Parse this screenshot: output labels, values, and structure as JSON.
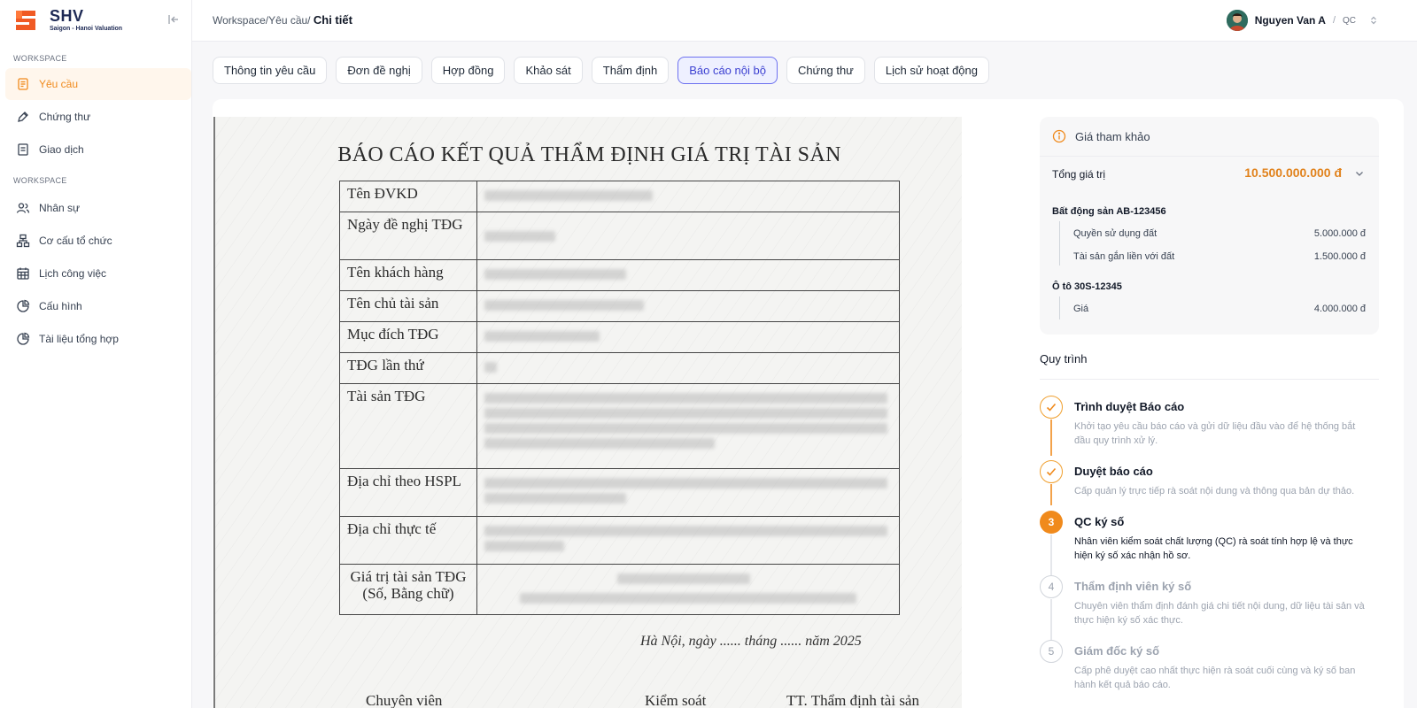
{
  "brand": {
    "name": "SHV",
    "subtitle": "Saigon - Hanoi Valuation"
  },
  "sidebar": {
    "section1": "WORKSPACE",
    "section2": "WORKSPACE",
    "items": [
      {
        "label": "Yêu cầu",
        "icon": "request-icon",
        "active": true
      },
      {
        "label": "Chứng thư",
        "icon": "pen-icon",
        "active": false
      },
      {
        "label": "Giao dịch",
        "icon": "document-icon",
        "active": false
      },
      {
        "label": "Nhân sự",
        "icon": "users-icon",
        "active": false
      },
      {
        "label": "Cơ cấu tổ chức",
        "icon": "org-chart-icon",
        "active": false
      },
      {
        "label": "Lịch công việc",
        "icon": "calendar-icon",
        "active": false
      },
      {
        "label": "Cấu hình",
        "icon": "pie-chart-icon",
        "active": false
      },
      {
        "label": "Tài liệu tổng hợp",
        "icon": "pie-chart-icon",
        "active": false
      }
    ]
  },
  "header": {
    "breadcrumb_prefix": "Workspace/Yêu cầu/",
    "breadcrumb_current": "Chi tiết",
    "user_name": "Nguyen Van A",
    "user_sep": "/",
    "user_role": "QC"
  },
  "tabs": [
    {
      "label": "Thông tin yêu cầu",
      "active": false
    },
    {
      "label": "Đơn đề nghị",
      "active": false
    },
    {
      "label": "Hợp đồng",
      "active": false
    },
    {
      "label": "Khảo sát",
      "active": false
    },
    {
      "label": "Thẩm định",
      "active": false
    },
    {
      "label": "Báo cáo nội bộ",
      "active": true
    },
    {
      "label": "Chứng thư",
      "active": false
    },
    {
      "label": "Lịch sử hoạt động",
      "active": false
    }
  ],
  "document": {
    "title": "BÁO CÁO KẾT QUẢ THẨM ĐỊNH GIÁ TRỊ TÀI SẢN",
    "rows": [
      {
        "label": "Tên ĐVKD",
        "lines": 1
      },
      {
        "label": "Ngày đề nghị TĐG",
        "lines": 2
      },
      {
        "label": "Tên khách hàng",
        "lines": 1
      },
      {
        "label": "Tên chủ tài sản",
        "lines": 1
      },
      {
        "label": "Mục đích TĐG",
        "lines": 1
      },
      {
        "label": "TĐG lần thứ",
        "lines": 1
      },
      {
        "label": "Tài sản TĐG",
        "lines": 4
      },
      {
        "label": "Địa chỉ theo HSPL",
        "lines": 2
      },
      {
        "label": "Địa chỉ thực tế",
        "lines": 2
      },
      {
        "label": "Giá trị tài sản TĐG (Số, Bằng chữ)",
        "lines": 2
      }
    ],
    "signature_line": "Hà Nội, ngày ...... tháng ...... năm 2025",
    "footer_left": "Chuyên viên",
    "footer_mid": "Kiểm soát",
    "footer_right": "TT. Thẩm định tài sản"
  },
  "reference": {
    "title": "Giá tham khảo",
    "total_label": "Tổng giá trị",
    "total_value": "10.500.000.000 đ",
    "assets": [
      {
        "title": "Bất động sản AB-123456",
        "items": [
          {
            "label": "Quyền sử dụng đất",
            "value": "5.000.000 đ"
          },
          {
            "label": "Tài sản gắn liền với đất",
            "value": "1.500.000 đ"
          }
        ]
      },
      {
        "title": "Ô tô 30S-12345",
        "items": [
          {
            "label": "Giá",
            "value": "4.000.000 đ"
          }
        ]
      }
    ]
  },
  "process": {
    "title": "Quy trình",
    "steps": [
      {
        "number": "1",
        "title": "Trình duyệt Báo cáo",
        "desc": "Khởi tạo yêu cầu báo cáo và gửi dữ liệu đầu vào để hệ thống bắt đầu quy trình xử lý.",
        "status": "done"
      },
      {
        "number": "2",
        "title": "Duyệt báo cáo",
        "desc": "Cấp quản lý trực tiếp rà soát nội dung và thông qua bản dự thảo.",
        "status": "done"
      },
      {
        "number": "3",
        "title": "QC ký số",
        "desc": "Nhân viên kiểm soát chất lượng (QC) rà soát tính hợp lệ và thực hiện ký số xác nhận hồ sơ.",
        "status": "current"
      },
      {
        "number": "4",
        "title": "Thẩm định viên ký số",
        "desc": "Chuyên viên thẩm định đánh giá chi tiết nội dung, dữ liệu tài sản và thực hiện ký số xác thực.",
        "status": "pending"
      },
      {
        "number": "5",
        "title": "Giám đốc ký số",
        "desc": "Cấp phê duyệt cao nhất thực hiện rà soát cuối cùng và ký số ban hành kết quả báo cáo.",
        "status": "pending"
      }
    ]
  },
  "colors": {
    "accent": "#f08a1c",
    "tab_active": "#3b3fd1",
    "brand": "#1e2a55"
  }
}
